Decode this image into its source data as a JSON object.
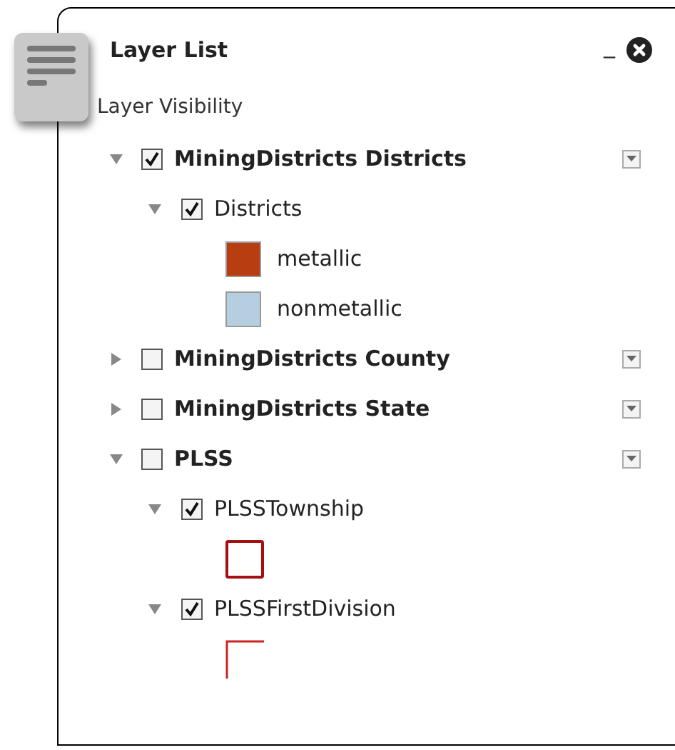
{
  "panel": {
    "title": "Layer List",
    "minimize": "_",
    "subtitle": "Layer Visibility"
  },
  "layers": [
    {
      "label": "MiningDistricts Districts",
      "expanded": true,
      "checked": true,
      "children": [
        {
          "label": "Districts",
          "expanded": true,
          "checked": true,
          "legend": [
            {
              "kind": "fill",
              "color": "#b83d10",
              "label": "metallic"
            },
            {
              "kind": "fill",
              "color": "#b5cfe0",
              "label": "nonmetallic"
            }
          ]
        }
      ]
    },
    {
      "label": "MiningDistricts County",
      "expanded": false,
      "checked": false
    },
    {
      "label": "MiningDistricts State",
      "expanded": false,
      "checked": false
    },
    {
      "label": "PLSS",
      "expanded": true,
      "checked": false,
      "children": [
        {
          "label": "PLSSTownship",
          "expanded": true,
          "checked": true,
          "legend": [
            {
              "kind": "outline",
              "color": "#a50f0f"
            }
          ]
        },
        {
          "label": "PLSSFirstDivision",
          "expanded": true,
          "checked": true,
          "legend": [
            {
              "kind": "line",
              "color": "#cc2222"
            }
          ]
        }
      ]
    }
  ]
}
